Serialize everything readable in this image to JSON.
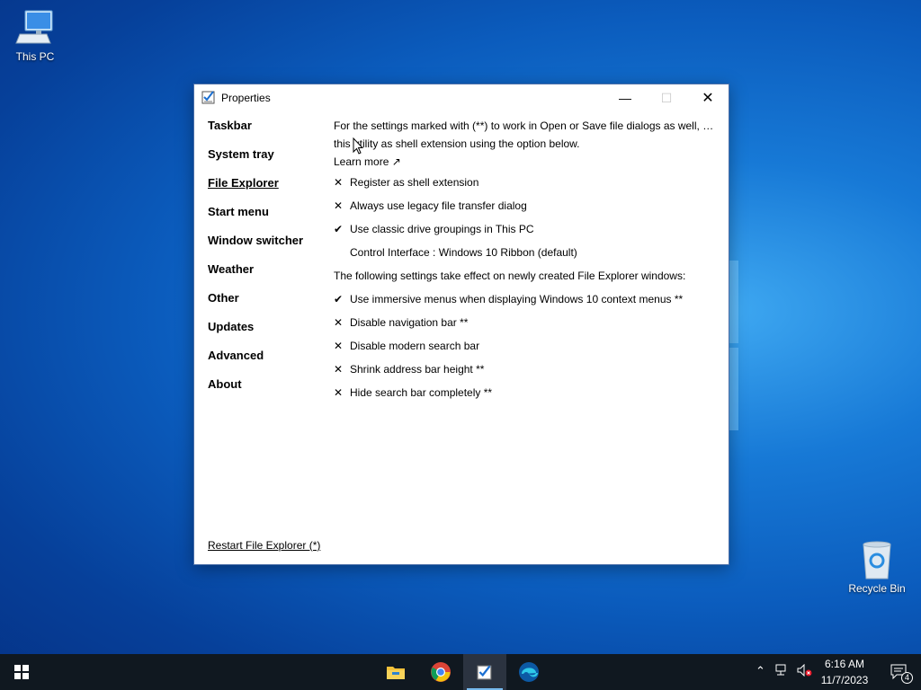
{
  "desktop": {
    "icons": [
      {
        "label": "This PC"
      },
      {
        "label": "Recycle Bin"
      }
    ]
  },
  "window": {
    "title": "Properties",
    "nav": [
      {
        "label": "Taskbar"
      },
      {
        "label": "System tray"
      },
      {
        "label": "File Explorer",
        "active": true
      },
      {
        "label": "Start menu"
      },
      {
        "label": "Window switcher"
      },
      {
        "label": "Weather"
      },
      {
        "label": "Other"
      },
      {
        "label": "Updates"
      },
      {
        "label": "Advanced"
      },
      {
        "label": "About"
      }
    ],
    "restart_label": "Restart File Explorer (*)",
    "description_line1": "For the settings marked with (**) to work in Open or Save file dialogs as well, re...",
    "description_line2": "this utility as shell extension using the option below.",
    "learn_more": "Learn more ↗",
    "options": [
      {
        "mark": "✕",
        "label": "Register as shell extension"
      },
      {
        "mark": "✕",
        "label": "Always use legacy file transfer dialog"
      },
      {
        "mark": "✔",
        "label": "Use classic drive groupings in This PC"
      },
      {
        "mark": "",
        "label": "Control Interface : Windows 10 Ribbon (default)"
      }
    ],
    "section_heading": "The following settings take effect on newly created File Explorer windows:",
    "options2": [
      {
        "mark": "✔",
        "label": "Use immersive menus when displaying Windows 10 context menus **"
      },
      {
        "mark": "✕",
        "label": "Disable navigation bar **"
      },
      {
        "mark": "✕",
        "label": "Disable modern search bar"
      },
      {
        "mark": "✕",
        "label": "Shrink address bar height **"
      },
      {
        "mark": "✕",
        "label": "Hide search bar completely **"
      }
    ]
  },
  "taskbar": {
    "time": "6:16 AM",
    "date": "11/7/2023",
    "notification_count": "4"
  },
  "colors": {
    "accent": "#0078d7",
    "taskbar": "#101820"
  }
}
